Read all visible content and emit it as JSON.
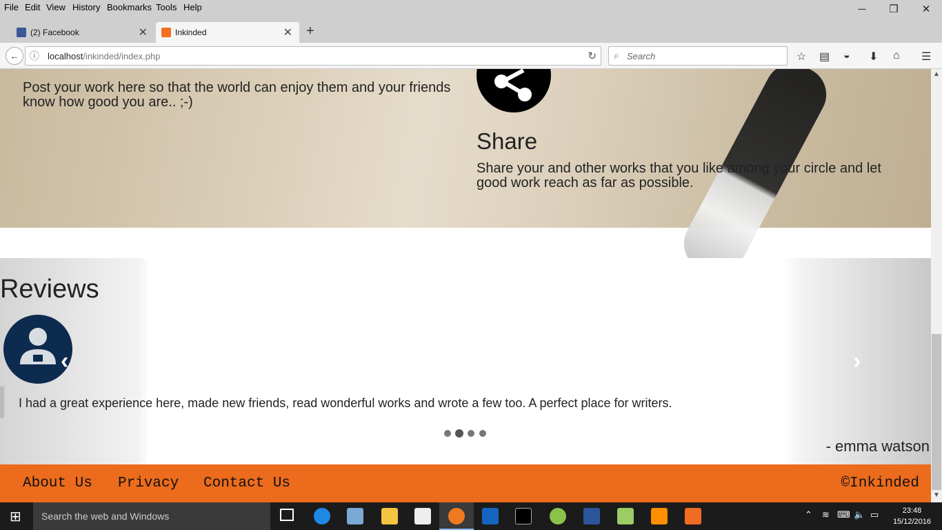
{
  "menu": [
    "File",
    "Edit",
    "View",
    "History",
    "Bookmarks",
    "Tools",
    "Help"
  ],
  "window_controls": {
    "minimize": "─",
    "restore": "❐",
    "close": "✕"
  },
  "tabs": [
    {
      "label": "(2) Facebook",
      "icon": "facebook-icon"
    },
    {
      "label": "Inkinded",
      "icon": "xampp-icon",
      "active": true
    }
  ],
  "new_tab": "+",
  "nav": {
    "url_host": "localhost",
    "url_path": "/inkinded/index.php",
    "search_placeholder": "Search"
  },
  "hero": {
    "post_text": "Post your work here so that the world can enjoy them and your friends know how good you are.. ;-)",
    "share_title": "Share",
    "share_text": "Share your and other works that you like among your circle and let good work reach as far as possible."
  },
  "reviews": {
    "title": "Reviews",
    "quote": "I had a great experience here, made new friends, read wonderful works and wrote a few too. A perfect place for writers.",
    "author": "- emma watson",
    "dots": 4
  },
  "footer": {
    "links": [
      "About Us",
      "Privacy",
      "Contact Us"
    ],
    "copyright": "©Inkinded"
  },
  "taskbar": {
    "search_placeholder": "Search the web and Windows",
    "time": "23:48",
    "date": "15/12/2016"
  },
  "colors": {
    "footer": "#ec6b1c",
    "avatar": "#0d2a4f"
  }
}
